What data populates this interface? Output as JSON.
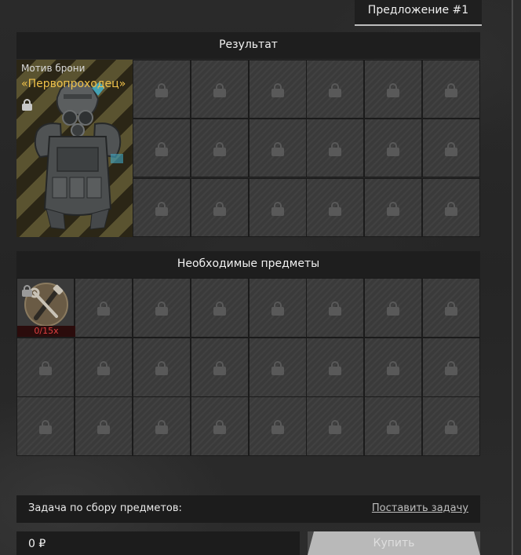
{
  "tab": {
    "label": "Предложение #1"
  },
  "result": {
    "header": "Результат",
    "item_title": "Мотив брони",
    "item_name": "«Первопроходец»",
    "colors": {
      "item_name": "#f0c24a"
    }
  },
  "required": {
    "header": "Необходимые предметы",
    "first_item_count": "0/15x",
    "colors": {
      "count": "#e04040"
    }
  },
  "task": {
    "label": "Задача по сбору предметов:",
    "link": "Поставить задачу"
  },
  "price": {
    "value": "0 ₽"
  },
  "buy": {
    "label": "Купить"
  },
  "icons": {
    "locked_slot": "lock-icon",
    "armor": "armor-vest-icon",
    "tools": "tools-crossed-icon"
  }
}
